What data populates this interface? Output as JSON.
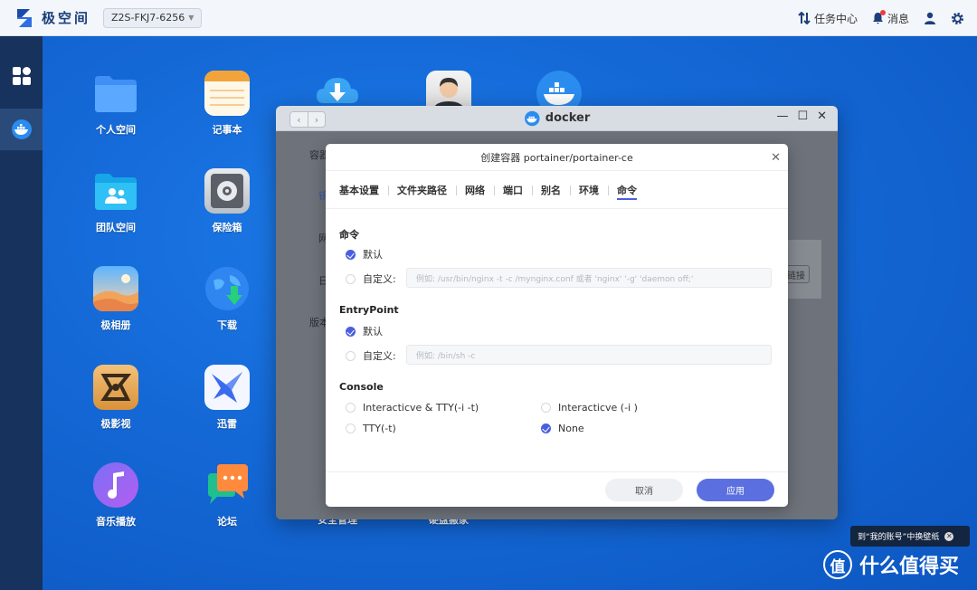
{
  "topbar": {
    "brand": "极空间",
    "device": "Z2S-FKJ7-6256",
    "task_center": "任务中心",
    "messages": "消息"
  },
  "apps": [
    {
      "label": "个人空间",
      "icon": "folder-icon"
    },
    {
      "label": "记事本",
      "icon": "notepad-icon"
    },
    {
      "label": "团队空间",
      "icon": "team-folder-icon"
    },
    {
      "label": "保险箱",
      "icon": "safe-icon"
    },
    {
      "label": "极相册",
      "icon": "photo-album-icon"
    },
    {
      "label": "下载",
      "icon": "download-globe-icon"
    },
    {
      "label": "极影视",
      "icon": "video-icon"
    },
    {
      "label": "迅雷",
      "icon": "thunder-icon"
    },
    {
      "label": "音乐播放",
      "icon": "music-icon"
    },
    {
      "label": "论坛",
      "icon": "forum-icon"
    },
    {
      "label": "安全管理",
      "icon": "cloud-download-icon"
    },
    {
      "label": "硬盘搬家",
      "icon": "avatar-icon"
    }
  ],
  "docker_window": {
    "title": "docker",
    "bg_labels": [
      "容器",
      "镜",
      "网",
      "日",
      "版本"
    ],
    "bg_button": "链接"
  },
  "dialog": {
    "title": "创建容器 portainer/portainer-ce",
    "tabs": [
      "基本设置",
      "文件夹路径",
      "网络",
      "端口",
      "别名",
      "环境",
      "命令"
    ],
    "active_tab": "命令",
    "command": {
      "title": "命令",
      "default_label": "默认",
      "custom_label": "自定义:",
      "placeholder": "例如: /usr/bin/nginx -t -c /mynginx.conf 或者 'nginx' '-g' 'daemon off;'"
    },
    "entrypoint": {
      "title": "EntryPoint",
      "default_label": "默认",
      "custom_label": "自定义:",
      "placeholder": "例如: /bin/sh -c"
    },
    "console": {
      "title": "Console",
      "opt1": "Interacticve & TTY(-i -t)",
      "opt2": "Interacticve (-i )",
      "opt3": "TTY(-t)",
      "opt4": "None",
      "selected": "None"
    },
    "cancel": "取消",
    "apply": "应用"
  },
  "toast": "到“我的账号”中换壁纸",
  "watermark": "什么值得买",
  "colors": {
    "accent": "#4a5ee0",
    "desktop": "#1467d4",
    "sidebar": "#17325c"
  }
}
